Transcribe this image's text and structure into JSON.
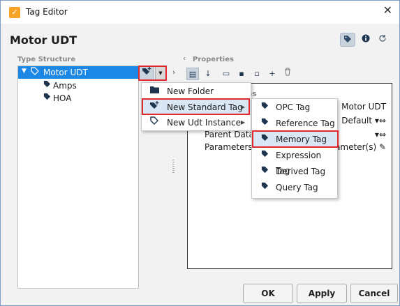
{
  "window": {
    "title": "Tag Editor",
    "close_glyph": "✕"
  },
  "header": {
    "title": "Motor UDT",
    "buttons": [
      {
        "name": "tag-view-icon",
        "glyph": "◆"
      },
      {
        "name": "info-icon",
        "glyph": "❶"
      },
      {
        "name": "refresh-icon",
        "glyph": "↻"
      }
    ]
  },
  "left_panel": {
    "label": "Type Structure",
    "root": {
      "label": "Motor UDT"
    },
    "children": [
      {
        "label": "Amps"
      },
      {
        "label": "HOA"
      }
    ]
  },
  "right_panel": {
    "label": "Properties",
    "header_partial": "ies",
    "rows": [
      {
        "label": "",
        "value": "Motor UDT"
      },
      {
        "label": "",
        "value": "Default ▾⇔"
      },
      {
        "label": "Parent Data",
        "value": "▾⇔"
      },
      {
        "label": "Parameters",
        "value": "arameter(s) ✎"
      }
    ]
  },
  "new_menu": {
    "items": [
      {
        "label": "New Folder",
        "icon": "folder-icon",
        "has_submenu": false
      },
      {
        "label": "New Standard Tag",
        "icon": "tag-add-icon",
        "has_submenu": true
      },
      {
        "label": "New Udt Instance",
        "icon": "udt-instance-icon",
        "has_submenu": true
      }
    ]
  },
  "standard_tag_menu": {
    "items": [
      {
        "label": "OPC Tag"
      },
      {
        "label": "Reference Tag"
      },
      {
        "label": "Memory Tag"
      },
      {
        "label": "Expression Tag"
      },
      {
        "label": "Derived Tag"
      },
      {
        "label": "Query Tag"
      }
    ]
  },
  "footer": {
    "ok": "OK",
    "apply": "Apply",
    "cancel": "Cancel"
  },
  "colors": {
    "selection": "#1c87e4",
    "highlight": "#e0282e",
    "hover": "#d9e6f4"
  }
}
